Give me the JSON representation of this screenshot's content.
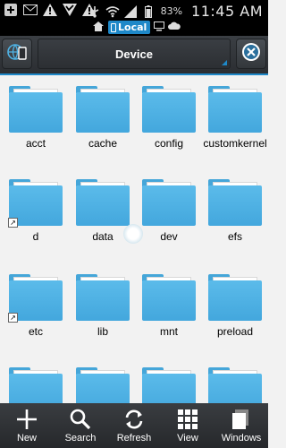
{
  "status_bar": {
    "battery_percent": "83%",
    "time": "11:45 AM",
    "icons": [
      "plus-icon",
      "mail-icon",
      "warning-icon",
      "check-triangle-icon",
      "warning-icon",
      "usb-icon",
      "wifi-icon",
      "signal-icon",
      "battery-icon"
    ]
  },
  "location": {
    "home_icon": "home-icon",
    "local_label": "Local",
    "other_icons": [
      "pc-icon",
      "cloud-icon"
    ]
  },
  "toolbar": {
    "path_label": "Device",
    "left_icon": "globe-phone-icon",
    "right_icon": "close-circle-icon"
  },
  "folders": [
    {
      "name": "acct",
      "shortcut": false
    },
    {
      "name": "cache",
      "shortcut": false
    },
    {
      "name": "config",
      "shortcut": false
    },
    {
      "name": "customkernel",
      "shortcut": false
    },
    {
      "name": "d",
      "shortcut": true
    },
    {
      "name": "data",
      "shortcut": false
    },
    {
      "name": "dev",
      "shortcut": false
    },
    {
      "name": "efs",
      "shortcut": false
    },
    {
      "name": "etc",
      "shortcut": true
    },
    {
      "name": "lib",
      "shortcut": false
    },
    {
      "name": "mnt",
      "shortcut": false
    },
    {
      "name": "preload",
      "shortcut": false
    },
    {
      "name": "",
      "shortcut": false
    },
    {
      "name": "",
      "shortcut": false
    },
    {
      "name": "",
      "shortcut": false
    },
    {
      "name": "",
      "shortcut": false
    }
  ],
  "bottom_bar": {
    "items": [
      {
        "label": "New",
        "icon": "plus-icon"
      },
      {
        "label": "Search",
        "icon": "search-icon"
      },
      {
        "label": "Refresh",
        "icon": "refresh-icon"
      },
      {
        "label": "View",
        "icon": "grid-view-icon"
      },
      {
        "label": "Windows",
        "icon": "windows-stack-icon"
      }
    ]
  },
  "colors": {
    "accent": "#1e88c8",
    "folder": "#4fb2e4",
    "toolbar": "#2f3236"
  }
}
